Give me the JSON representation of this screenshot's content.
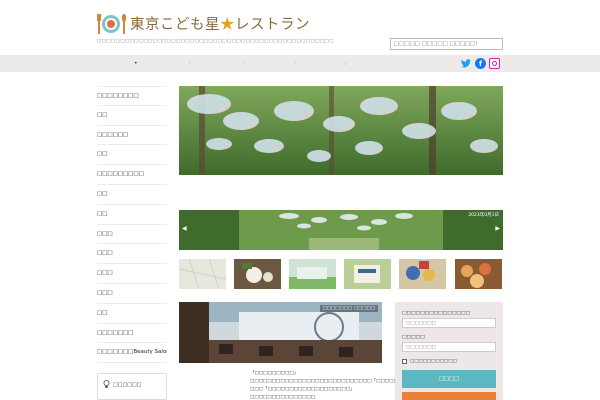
{
  "header": {
    "site_title_pre": "東京こども星",
    "site_title_star": "★",
    "site_title_post": "レストラン",
    "tagline": "□□□□□□□□□□□□□□□□□□□□□□□□□□□□□□□□□□□□□□□□□□□□□□□□□□□",
    "search_placeholder": "□□□□□ □□□□□ □□□□□!"
  },
  "nav": {
    "items": [
      "•",
      "",
      "",
      "",
      "",
      "",
      ""
    ],
    "social": [
      {
        "name": "twitter-icon",
        "glyph": "🐦",
        "color": "#1da1f2"
      },
      {
        "name": "facebook-icon",
        "glyph": "f",
        "color": "#1877f2"
      },
      {
        "name": "instagram-icon",
        "glyph": "",
        "color": "#d6249f"
      }
    ]
  },
  "sidebar": {
    "items": [
      {
        "label": "□□□□□□□□"
      },
      {
        "label": "□□"
      },
      {
        "label": "□□□□□□"
      },
      {
        "label": "□□"
      },
      {
        "label": "□□□□□□□□□"
      },
      {
        "label": "□□"
      },
      {
        "label": "□□"
      },
      {
        "label": "□□□"
      },
      {
        "label": "□□□"
      },
      {
        "label": "□□□"
      },
      {
        "label": "□□□"
      },
      {
        "label": "□□"
      },
      {
        "label": "□□□□□□□"
      },
      {
        "label": "□□□□□□□Beauty Salon"
      }
    ],
    "box_label": "□□□□□□"
  },
  "slider": {
    "date": "2023年0月1日",
    "prev": "◀",
    "next": "▶"
  },
  "feature": {
    "tag": "□□□□□□□ □□□□□",
    "text": "「□□□□□□□□□」□□□□□□□□□□□□□□□□□□□□□□□□□□□□「□□□□□」□□□「□□□□□□□□□□□□□□□□□□□」□□□□□□□□□□□□□□□ □□□□□□□□□□□□□□□□□□□□□□□□□□□□□□□□□□□□□□□□□□□□ ..."
  },
  "login": {
    "username_label": "□□□□□□□□□□□□□□□",
    "username_placeholder": "□□□□□□□",
    "password_label": "□□□□□",
    "password_placeholder": "□□□□□□□",
    "remember_label": "□□□□□□□□□□□",
    "submit_label": "□□□□"
  },
  "colors": {
    "nav_bg": "#efeaea",
    "login_button": "#5bb8c2",
    "register_button": "#e8803a",
    "login_panel_bg": "#ede7e7"
  }
}
